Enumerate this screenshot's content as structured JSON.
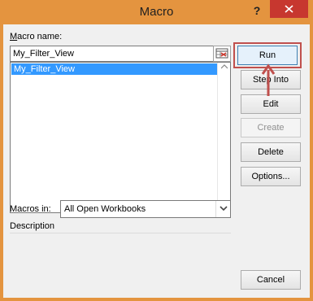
{
  "window": {
    "title": "Macro",
    "help_label": "?"
  },
  "macro_name": {
    "label": "Macro name:",
    "mnemonic": "M",
    "value": "My_Filter_View"
  },
  "macro_list": {
    "items": [
      "My_Filter_View"
    ],
    "selected": "My_Filter_View"
  },
  "buttons": {
    "run": "Run",
    "step_into": "Step Into",
    "edit": "Edit",
    "create": "Create",
    "delete": "Delete",
    "options": "Options...",
    "cancel": "Cancel"
  },
  "macros_in": {
    "label": "Macros in:",
    "value": "All Open Workbooks"
  },
  "description": {
    "label": "Description"
  },
  "colors": {
    "title_bar": "#e4943f",
    "close_button": "#c7372f",
    "selection": "#3399ff",
    "annotation": "#c0504d"
  }
}
